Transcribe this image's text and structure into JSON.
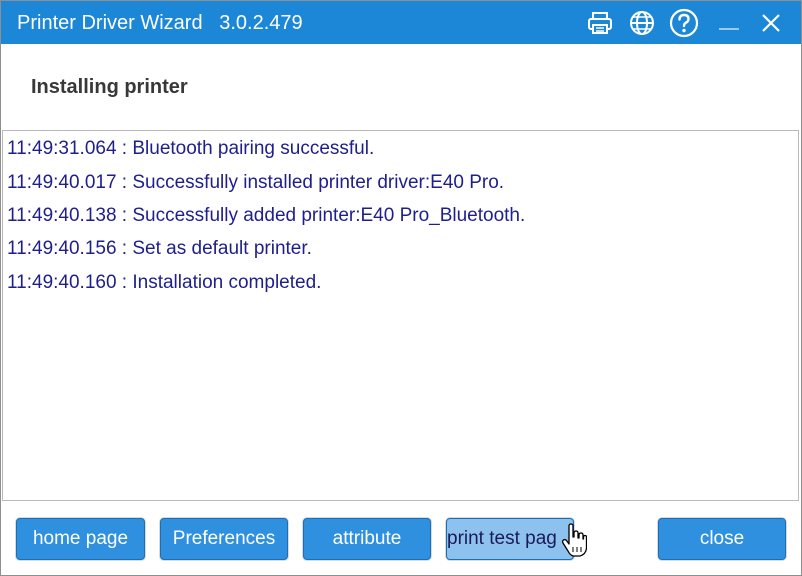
{
  "window": {
    "title": "Printer Driver Wizard   3.0.2.479",
    "controls": {
      "print_icon": "printer-icon",
      "language_icon": "globe-icon",
      "help_icon": "help-icon",
      "minimize_label": "—",
      "close_label": "✕"
    }
  },
  "header": {
    "title": "Installing printer"
  },
  "log": {
    "lines": [
      "11:49:31.064 : Bluetooth pairing successful.",
      "11:49:40.017 : Successfully installed printer driver:E40 Pro.",
      "11:49:40.138 : Successfully added printer:E40 Pro_Bluetooth.",
      "11:49:40.156 : Set as default printer.",
      "11:49:40.160 : Installation completed."
    ]
  },
  "buttons": {
    "home": "home page",
    "preferences": "Preferences",
    "attribute": "attribute",
    "print_test": "print test pag",
    "close": "close"
  },
  "colors": {
    "titlebar": "#1c87d7",
    "button": "#2f90df",
    "button_pressed": "#8ec2ee",
    "log_text": "#1e1e8c"
  }
}
